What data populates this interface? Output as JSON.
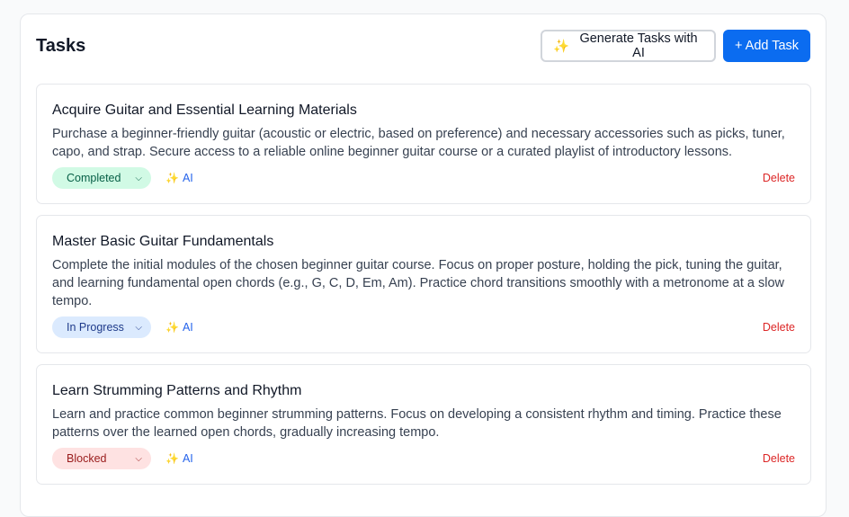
{
  "header": {
    "title": "Tasks",
    "generate_label": "Generate Tasks with AI",
    "generate_icon": "✨",
    "add_label": "+ Add Task"
  },
  "tasks": [
    {
      "title": "Acquire Guitar and Essential Learning Materials",
      "description": "Purchase a beginner-friendly guitar (acoustic or electric, based on preference) and necessary accessories such as picks, tuner, capo, and strap. Secure access to a reliable online beginner guitar course or a curated playlist of introductory lessons.",
      "status": "Completed",
      "ai_label": "AI",
      "delete_label": "Delete"
    },
    {
      "title": "Master Basic Guitar Fundamentals",
      "description": "Complete the initial modules of the chosen beginner guitar course. Focus on proper posture, holding the pick, tuning the guitar, and learning fundamental open chords (e.g., G, C, D, Em, Am). Practice chord transitions smoothly with a metronome at a slow tempo.",
      "status": "In Progress",
      "ai_label": "AI",
      "delete_label": "Delete"
    },
    {
      "title": "Learn Strumming Patterns and Rhythm",
      "description": "Learn and practice common beginner strumming patterns. Focus on developing a consistent rhythm and timing. Practice these patterns over the learned open chords, gradually increasing tempo.",
      "status": "Blocked",
      "ai_label": "AI",
      "delete_label": "Delete"
    }
  ],
  "colors": {
    "primary": "#0b6cf0",
    "completed_bg": "#d1fae5",
    "in_progress_bg": "#dbeafe",
    "blocked_bg": "#fee2e2",
    "delete": "#dc2626",
    "ai_link": "#2563eb"
  }
}
